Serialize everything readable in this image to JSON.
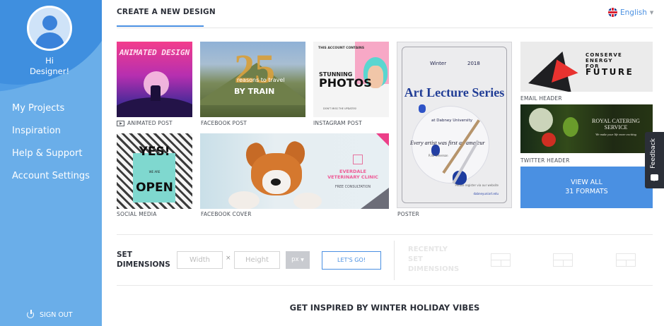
{
  "sidebar": {
    "greeting_line1": "Hi",
    "greeting_line2": "Designer!",
    "nav": [
      "My Projects",
      "Inspiration",
      "Help & Support",
      "Account Settings"
    ],
    "signout": "SIGN OUT"
  },
  "header": {
    "title": "CREATE A NEW DESIGN",
    "language": "English"
  },
  "tiles": {
    "animated_post": {
      "label": "ANIMATED POST",
      "art_text": "ANIMATED DESIGN"
    },
    "facebook_post": {
      "label": "FACEBOOK POST",
      "art_number": "25",
      "art_sub": "reasons to travel",
      "art_text": "BY TRAIN"
    },
    "instagram_post": {
      "label": "INSTAGRAM POST",
      "art_small": "THIS ACCOUNT CONTAINS",
      "art_line1": "STUNNING",
      "art_line2": "PHOTOS",
      "art_bottom": "DON'T MISS THE UPDATES!"
    },
    "poster": {
      "label": "POSTER",
      "season": "Winter",
      "year": "2018",
      "title": "Art Lecture Series",
      "university": "at Dabney University",
      "quote": "Every artist was first an amateur",
      "author": "R.W. Emerson",
      "footer": "Please register via our website",
      "website": "dabneyuniart.edu"
    },
    "email_header": {
      "label": "EMAIL HEADER",
      "art_line1": "CONSERVE",
      "art_line2": "ENERGY",
      "art_line3": "FOR",
      "art_line4": "FUTURE"
    },
    "twitter_header": {
      "label": "TWITTER HEADER",
      "art_line1": "ROYAL CATERING",
      "art_line2": "SERVICE",
      "art_line3": "We make your life more exciting"
    },
    "view_all": {
      "line1": "VIEW ALL",
      "line2": "31 FORMATS"
    },
    "social_media": {
      "label": "SOCIAL MEDIA",
      "art_top": "YES!",
      "art_mid": "WE   ARE",
      "art_bottom": "OPEN"
    },
    "facebook_cover": {
      "label": "FACEBOOK COVER",
      "art_line1": "EVERDALE",
      "art_line2": "VETERINARY CLINIC",
      "art_line3": "FREE CONSULTATION"
    }
  },
  "dimensions": {
    "title_line1": "SET",
    "title_line2": "DIMENSIONS",
    "width_placeholder": "Width",
    "height_placeholder": "Height",
    "times": "×",
    "unit": "px",
    "go_label": "LET'S GO!",
    "recent_line1": "RECENTLY",
    "recent_line2": "SET",
    "recent_line3": "DIMENSIONS"
  },
  "inspire_heading": "GET INSPIRED BY WINTER HOLIDAY VIBES",
  "feedback_label": "Feedback",
  "colors": {
    "sidebar": "#6aaee9",
    "accent": "#4a90e2",
    "dark_text": "#2b2f38"
  }
}
